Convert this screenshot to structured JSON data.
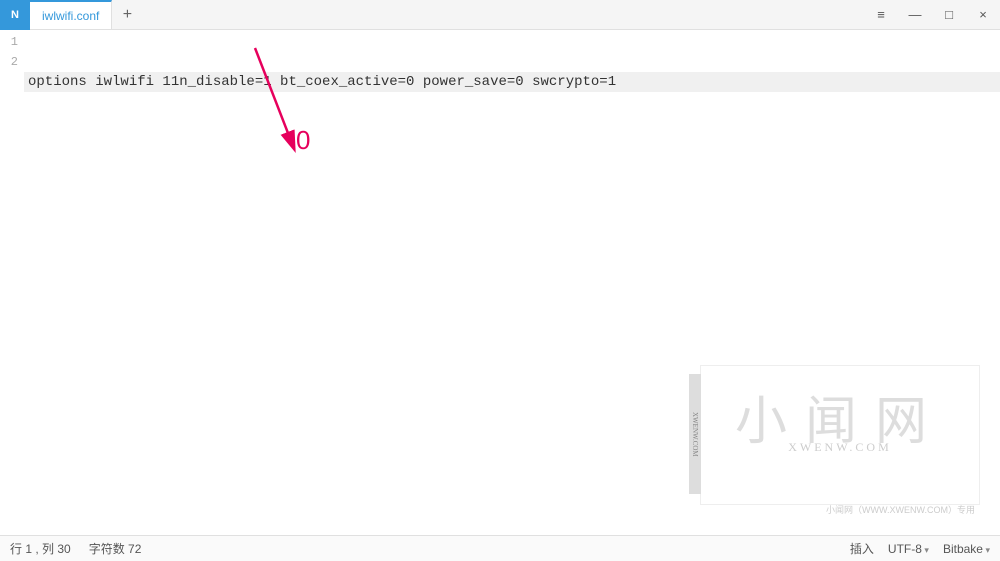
{
  "window": {
    "app_icon_letter": "N",
    "tab_title": "iwlwifi.conf",
    "new_tab_glyph": "+",
    "hamburger_glyph": "≡",
    "minimize_glyph": "—",
    "maximize_glyph": "□",
    "close_glyph": "×"
  },
  "editor": {
    "lines": {
      "n1": "1",
      "n2": "2"
    },
    "content_line1": "options iwlwifi 11n_disable=1 bt_coex_active=0 power_save=0 swcrypto=1",
    "content_line2": ""
  },
  "annotation": {
    "zero_label": "0"
  },
  "watermark": {
    "vtab": "XWENW.COM",
    "big": "小闻网",
    "url": "XWENW.COM",
    "tiny": "小闻网（WWW.XWENW.COM）专用"
  },
  "status": {
    "pos": "行 1 , 列 30",
    "chars": "字符数 72",
    "insert": "插入",
    "encoding": "UTF-8",
    "language": "Bitbake"
  }
}
